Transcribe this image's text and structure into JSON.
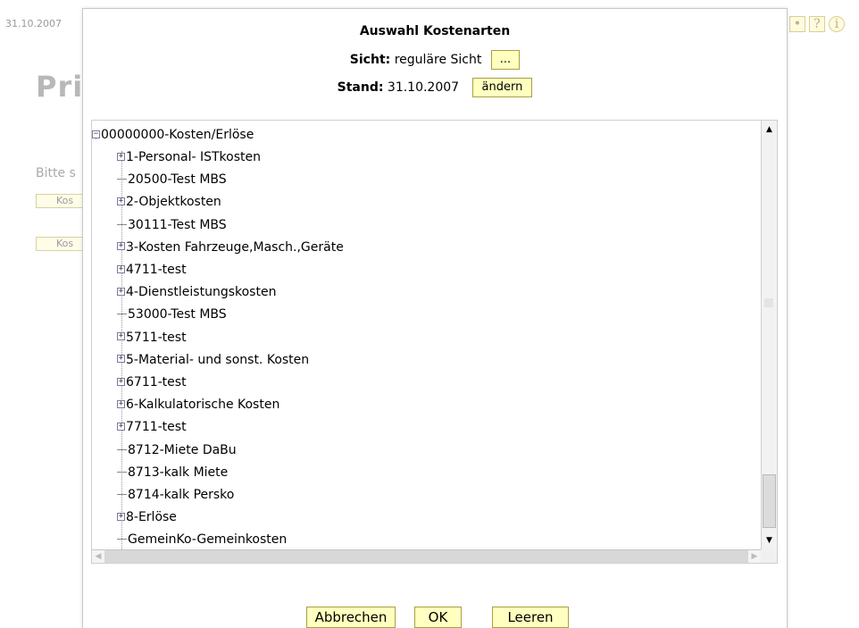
{
  "background": {
    "date": "31.10.2007",
    "title": "Pri",
    "hint": "Bitte s",
    "buttons": [
      "Kos",
      "Kos"
    ],
    "icons": [
      "bullet-icon",
      "help-icon",
      "info-icon"
    ]
  },
  "dialog": {
    "title": "Auswahl Kostenarten",
    "sicht_label": "Sicht:",
    "sicht_value": "reguläre Sicht",
    "sicht_button": "...",
    "stand_label": "Stand:",
    "stand_value": "31.10.2007",
    "stand_button": "ändern",
    "tree": {
      "root": "00000000-Kosten/Erlöse",
      "items": [
        {
          "label": "1-Personal- ISTkosten",
          "expandable": true
        },
        {
          "label": "20500-Test MBS",
          "expandable": false
        },
        {
          "label": "2-Objektkosten",
          "expandable": true
        },
        {
          "label": "30111-Test MBS",
          "expandable": false
        },
        {
          "label": "3-Kosten Fahrzeuge,Masch.,Geräte",
          "expandable": true
        },
        {
          "label": "4711-test",
          "expandable": true
        },
        {
          "label": "4-Dienstleistungskosten",
          "expandable": true
        },
        {
          "label": "53000-Test MBS",
          "expandable": false
        },
        {
          "label": "5711-test",
          "expandable": true
        },
        {
          "label": "5-Material- und sonst. Kosten",
          "expandable": true
        },
        {
          "label": "6711-test",
          "expandable": true
        },
        {
          "label": "6-Kalkulatorische Kosten",
          "expandable": true
        },
        {
          "label": "7711-test",
          "expandable": true
        },
        {
          "label": "8712-Miete DaBu",
          "expandable": false
        },
        {
          "label": "8713-kalk Miete",
          "expandable": false
        },
        {
          "label": "8714-kalk Persko",
          "expandable": false
        },
        {
          "label": "8-Erlöse",
          "expandable": true
        },
        {
          "label": "GemeinKo-Gemeinkosten",
          "expandable": false
        }
      ]
    },
    "buttons": {
      "cancel": "Abbrechen",
      "ok": "OK",
      "clear": "Leeren"
    }
  },
  "colors": {
    "button_bg": "#ffffbf",
    "button_border": "#a8a048"
  }
}
